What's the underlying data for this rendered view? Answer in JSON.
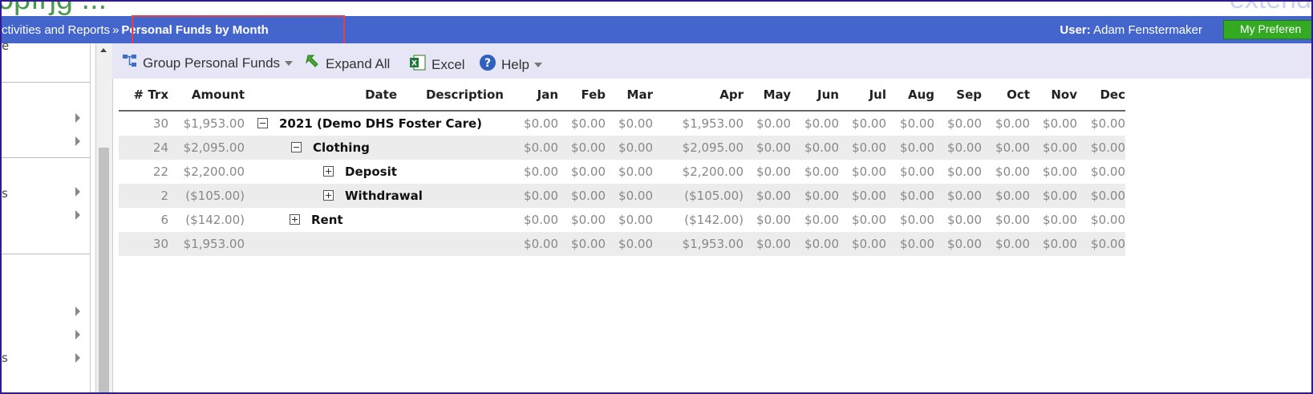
{
  "banner": {
    "left_fragment": "ɔpıŋg ...",
    "right_fragment": "extend"
  },
  "breadcrumb": {
    "parent": "ctivities and Reports",
    "separator": "»",
    "current": "Personal Funds by Month"
  },
  "user": {
    "label": "User:",
    "name": "Adam Fenstermaker"
  },
  "preferences_button": "My Preferen",
  "sidebar": {
    "fragments": [
      "e",
      "s",
      "s"
    ]
  },
  "toolbar": {
    "group_label": "Group Personal Funds",
    "expand_label": "Expand All",
    "excel_label": "Excel",
    "help_label": "Help"
  },
  "table": {
    "headers": {
      "trx": "# Trx",
      "amount": "Amount",
      "date": "Date",
      "description": "Description",
      "months": [
        "Jan",
        "Feb",
        "Mar",
        "Apr",
        "May",
        "Jun",
        "Jul",
        "Aug",
        "Sep",
        "Oct",
        "Nov",
        "Dec"
      ]
    },
    "rows": [
      {
        "trx": "30",
        "amount": "$1,953.00",
        "label": "2021 (Demo DHS Foster Care)",
        "toggle": "minus",
        "months": [
          "$0.00",
          "$0.00",
          "$0.00",
          "$1,953.00",
          "$0.00",
          "$0.00",
          "$0.00",
          "$0.00",
          "$0.00",
          "$0.00",
          "$0.00",
          "$0.00"
        ]
      },
      {
        "trx": "24",
        "amount": "$2,095.00",
        "label": "Clothing",
        "toggle": "minus",
        "months": [
          "$0.00",
          "$0.00",
          "$0.00",
          "$2,095.00",
          "$0.00",
          "$0.00",
          "$0.00",
          "$0.00",
          "$0.00",
          "$0.00",
          "$0.00",
          "$0.00"
        ]
      },
      {
        "trx": "22",
        "amount": "$2,200.00",
        "label": "Deposit",
        "toggle": "plus",
        "months": [
          "$0.00",
          "$0.00",
          "$0.00",
          "$2,200.00",
          "$0.00",
          "$0.00",
          "$0.00",
          "$0.00",
          "$0.00",
          "$0.00",
          "$0.00",
          "$0.00"
        ]
      },
      {
        "trx": "2",
        "amount": "($105.00)",
        "label": "Withdrawal",
        "toggle": "plus",
        "months": [
          "$0.00",
          "$0.00",
          "$0.00",
          "($105.00)",
          "$0.00",
          "$0.00",
          "$0.00",
          "$0.00",
          "$0.00",
          "$0.00",
          "$0.00",
          "$0.00"
        ]
      },
      {
        "trx": "6",
        "amount": "($142.00)",
        "label": "Rent",
        "toggle": "plus",
        "months": [
          "$0.00",
          "$0.00",
          "$0.00",
          "($142.00)",
          "$0.00",
          "$0.00",
          "$0.00",
          "$0.00",
          "$0.00",
          "$0.00",
          "$0.00",
          "$0.00"
        ]
      },
      {
        "trx": "30",
        "amount": "$1,953.00",
        "label": "",
        "toggle": "none",
        "months": [
          "$0.00",
          "$0.00",
          "$0.00",
          "$1,953.00",
          "$0.00",
          "$0.00",
          "$0.00",
          "$0.00",
          "$0.00",
          "$0.00",
          "$0.00",
          "$0.00"
        ]
      }
    ]
  }
}
